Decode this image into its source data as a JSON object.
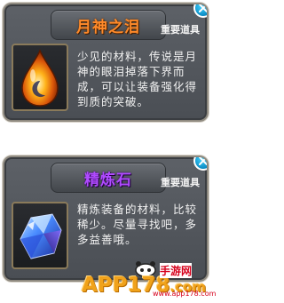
{
  "items": [
    {
      "title": "月神之泪",
      "tag": "重要道具",
      "description": "少见的材料，传说是月神的眼泪掉落下界而成，可以让装备强化得到质的突破。",
      "icon": "teardrop-gem-icon"
    },
    {
      "title": "精炼石",
      "tag": "重要道具",
      "description": "精炼装备的材料，比较稀少。尽量寻找吧，多多益善哦。",
      "icon": "blue-crystal-icon"
    }
  ],
  "watermark": {
    "brand": "APP178",
    "suffix": ".com",
    "chinese": "手游网",
    "domain": "www.app178.com"
  },
  "colors": {
    "title_orange": "#ff8a2a",
    "title_purple": "#b04bff",
    "panel_bg": "#53575d",
    "close_button": "#1aa4dc"
  }
}
